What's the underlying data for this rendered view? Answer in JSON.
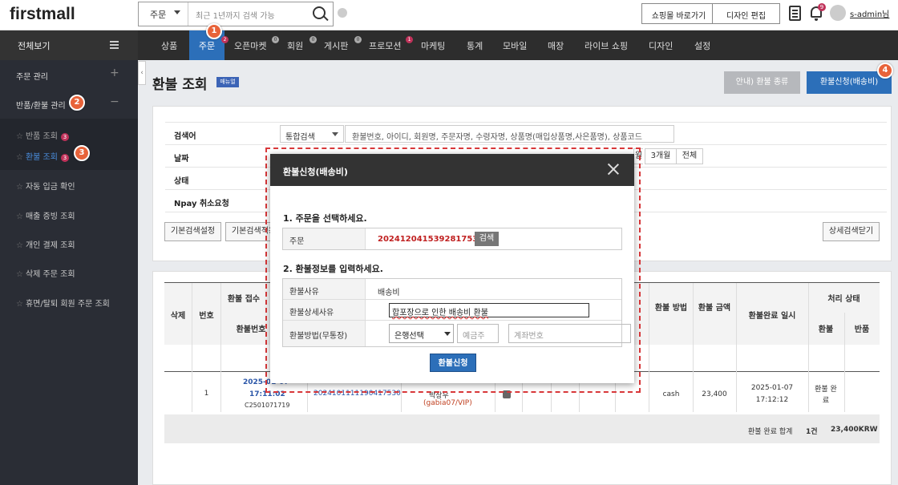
{
  "header": {
    "logo": "firstmall",
    "search_scope": "주문",
    "search_placeholder": "최근 1년까지 검색 가능",
    "shop_button": "쇼핑몰 바로가기",
    "design_button": "디자인 편집",
    "bell_badge": "9",
    "admin_name": "s-admin님"
  },
  "nav": {
    "all_view": "전체보기",
    "items": [
      {
        "label": "상품"
      },
      {
        "label": "주문",
        "badge": "2"
      },
      {
        "label": "오픈마켓",
        "badge": "0"
      },
      {
        "label": "회원",
        "badge": "0"
      },
      {
        "label": "게시판",
        "badge": "0"
      },
      {
        "label": "프로모션",
        "badge": "1"
      },
      {
        "label": "마케팅"
      },
      {
        "label": "통계"
      },
      {
        "label": "모바일"
      },
      {
        "label": "매장"
      },
      {
        "label": "라이브 쇼핑"
      },
      {
        "label": "디자인"
      },
      {
        "label": "설정"
      }
    ]
  },
  "sidebar": {
    "order_manage": "주문 관리",
    "return_manage": "반품/환불 관리",
    "return_view": "반품 조회",
    "return_badge": "3",
    "refund_view": "환불 조회",
    "refund_badge": "3",
    "items": [
      {
        "label": "자동 입금 확인"
      },
      {
        "label": "매출 증빙 조회"
      },
      {
        "label": "개인 결제 조회"
      },
      {
        "label": "삭제 주문 조회"
      },
      {
        "label": "휴면/탈퇴 회원 주문 조회"
      }
    ]
  },
  "callouts": [
    "1",
    "2",
    "3",
    "4"
  ],
  "page": {
    "title": "환불 조회",
    "manual": "매뉴얼",
    "guide_button": "안내) 환불 종류",
    "refund_request_button": "환불신청(배송비)"
  },
  "filter": {
    "search_label": "검색어",
    "search_type": "통합검색",
    "search_hint": "환불번호, 아이디, 회원명, 주문자명, 수령자명, 상품명(매입상품명,사은품명), 상품코드",
    "date_label": "날짜",
    "date_btn_3m": "3개월",
    "date_btn_all": "전체",
    "date_partial": "월",
    "status_label": "상태",
    "npay_label": "Npay 취소요청",
    "basic_setting": "기본검색설정",
    "basic_apply": "기본검색적용",
    "detail_close": "상세검색닫기"
  },
  "table": {
    "headers": {
      "delete": "삭제",
      "no": "번호",
      "received": "환불 접수",
      "refund_no": "환불번호",
      "method": "환불 방법",
      "amount": "환불 금액",
      "done_at": "환불완료 일시",
      "status": "처리 상태",
      "status_refund": "환불",
      "status_return": "반품"
    },
    "row": {
      "no": "1",
      "date": "2025-01-07",
      "time": "17:11:02",
      "refund_code": "C2501071719",
      "order_no": "2024101111190417530",
      "buyer": "박상우",
      "buyer_id": "(gabia07/VIP)",
      "method": "cash",
      "amount": "23,400",
      "done_date": "2025-01-07",
      "done_time": "17:12:12",
      "status": "환불 완료"
    },
    "summary": {
      "label": "환불 완료 합계",
      "count": "1건",
      "total": "23,400KRW"
    }
  },
  "modal": {
    "title": "환불신청(배송비)",
    "step1": "1. 주문을 선택하세요.",
    "order_label": "주문",
    "order_no": "2024120415392817530",
    "search_btn": "검색",
    "step2": "2. 환불정보를 입력하세요.",
    "reason_label": "환불사유",
    "reason_value": "배송비",
    "detail_label": "환불상세사유",
    "detail_value": "합포장으로 인한 배송비 환불",
    "method_label": "환불방법(무통장)",
    "bank_select": "은행선택",
    "holder_placeholder": "예금주",
    "account_placeholder": "계좌번호",
    "submit": "환불신청"
  }
}
